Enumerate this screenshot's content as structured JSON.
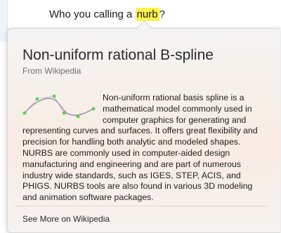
{
  "document": {
    "text_before": "Who you calling a ",
    "highlighted_word": "nurb",
    "text_after": "?",
    "highlight_color": "#fdf24c"
  },
  "popover": {
    "title": "Non-uniform rational B-spline",
    "source": "From Wikipedia",
    "thumbnail_icon": "nurbs-curve-thumbnail",
    "description": "Non-uniform rational basis spline is a mathematical model commonly used in computer graphics for generating and representing curves and surfaces. It offers great flexibility and precision for handling both analytic and modeled shapes. NURBS are commonly used in computer-aided design  manufacturing  and engineering and are part of numerous industry wide standards, such as IGES, STEP, ACIS, and PHIGS. NURBS tools are also found in various 3D modeling and animation software packages.",
    "see_more": "See More on Wikipedia"
  },
  "colors": {
    "control_points": "#5cd04a",
    "curve": "#9b8fb0"
  }
}
